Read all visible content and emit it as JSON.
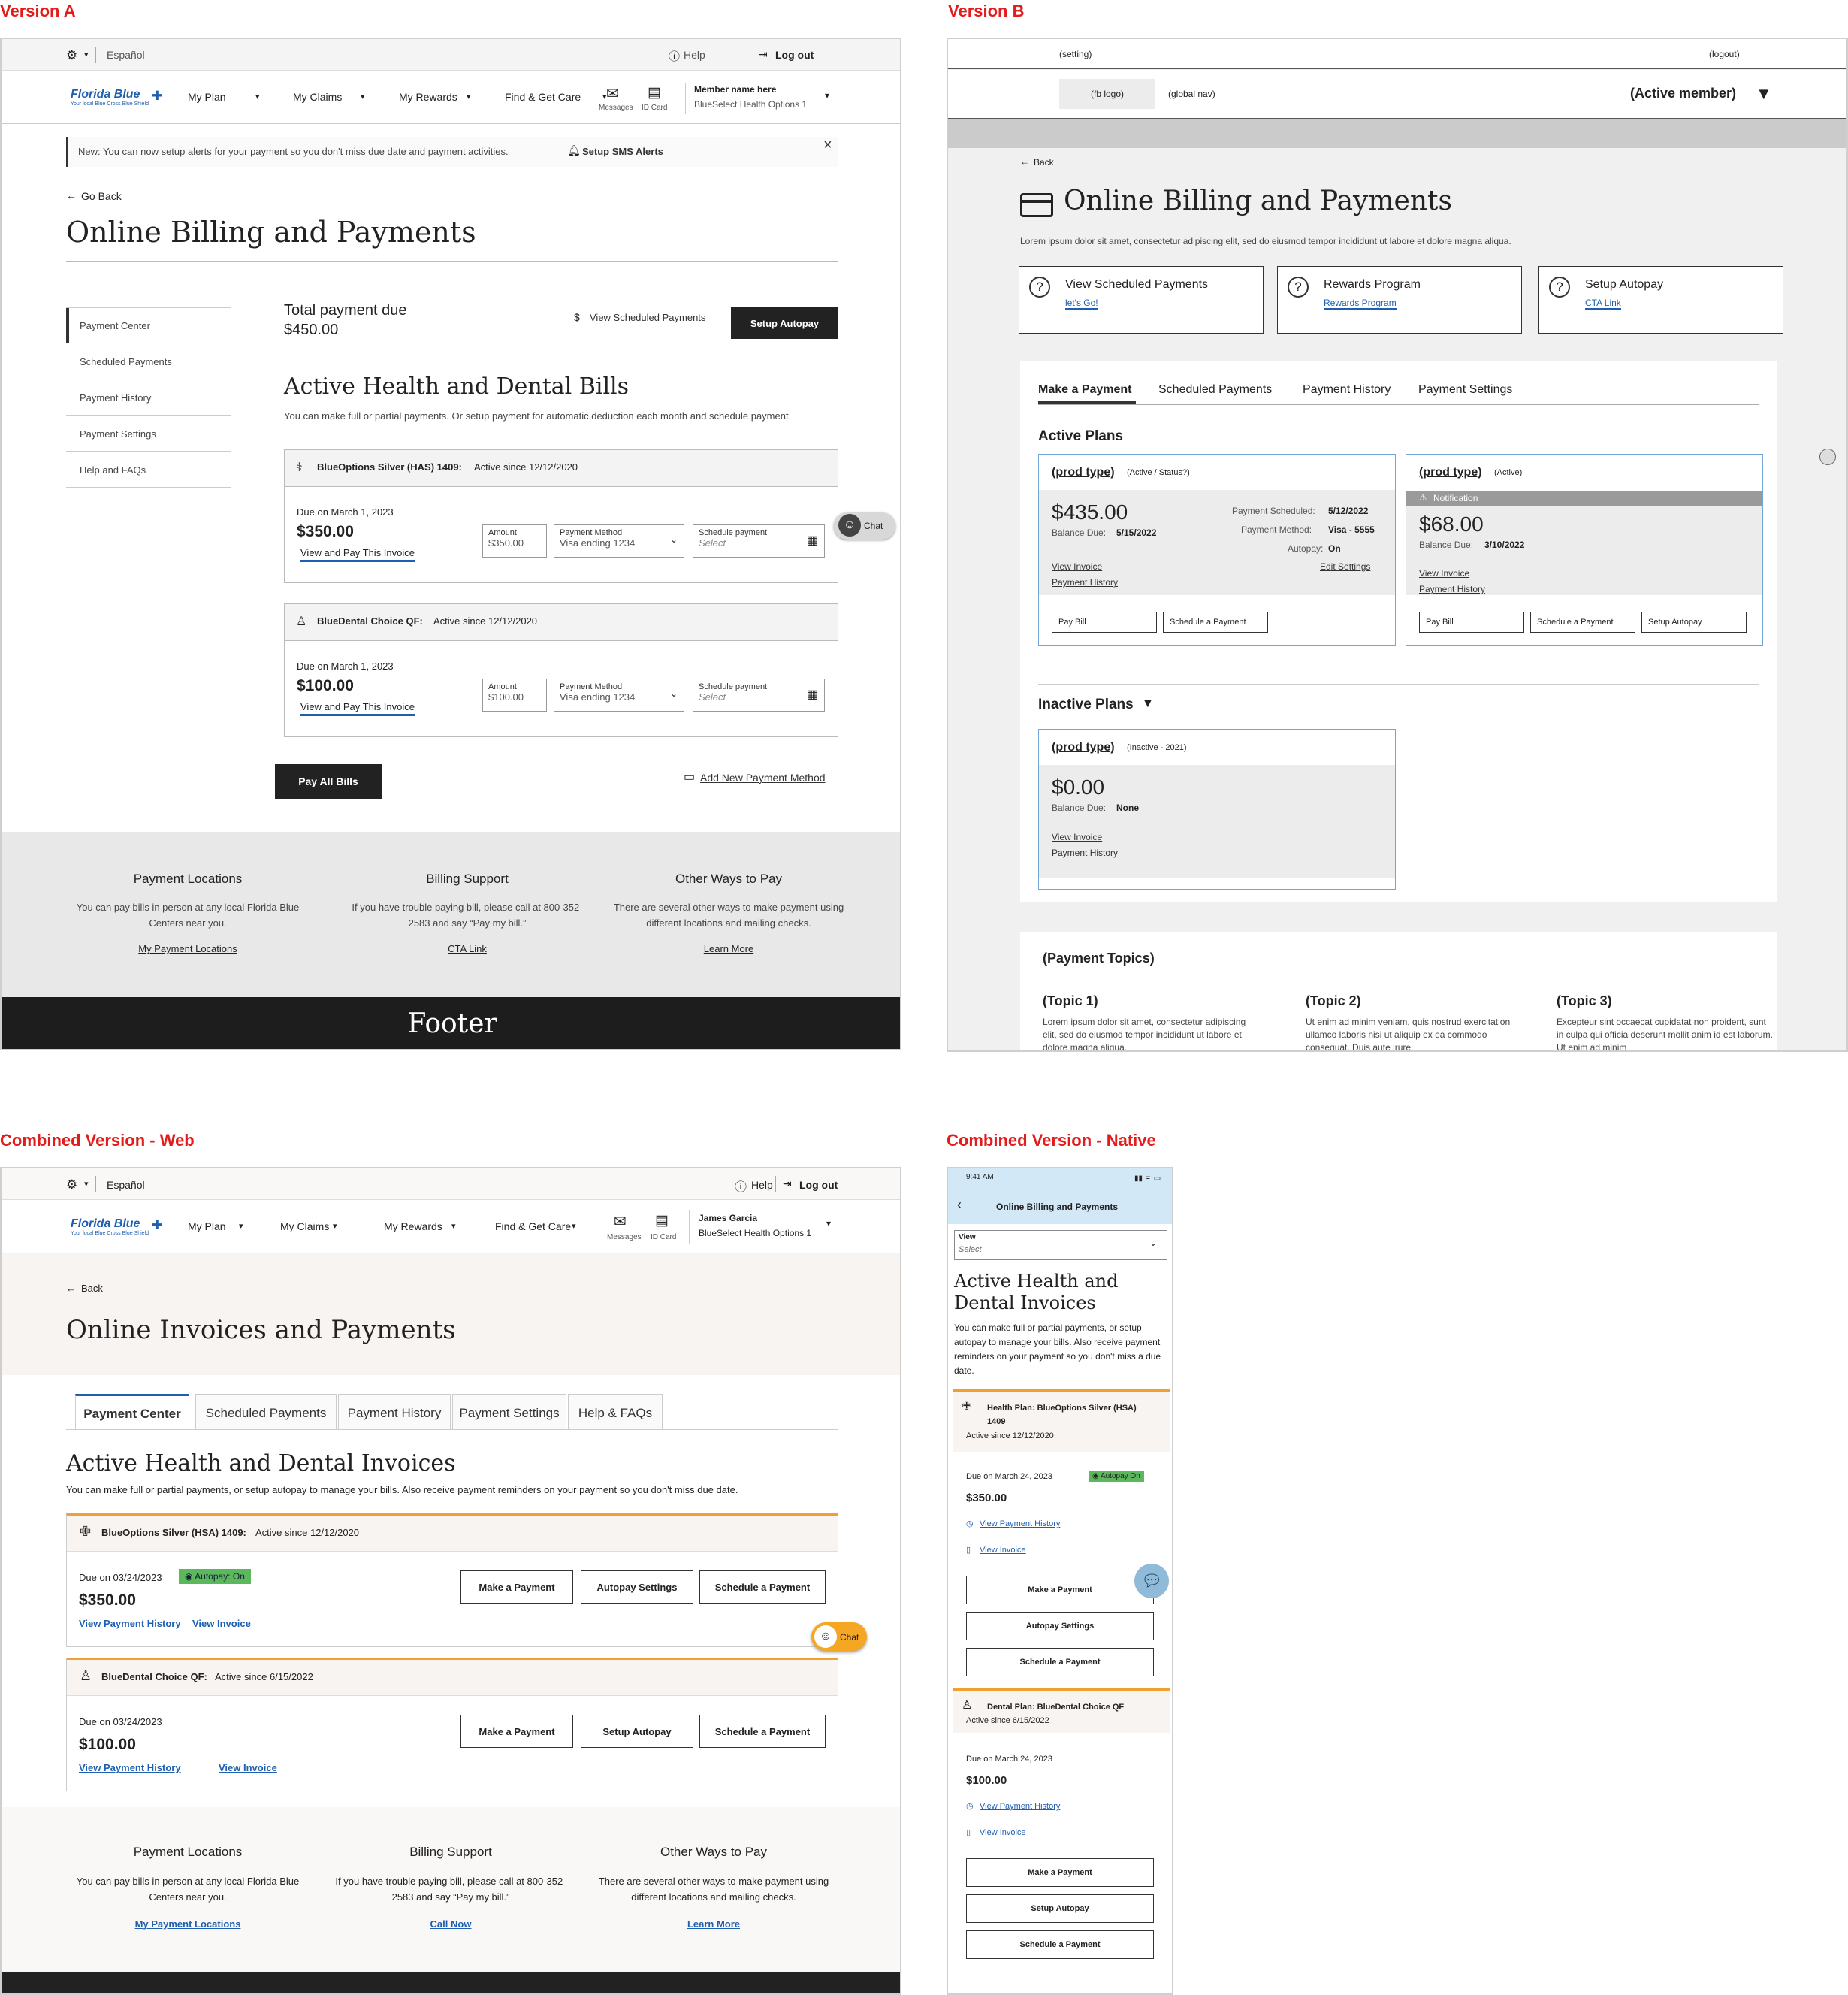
{
  "labels": {
    "a": "Version A",
    "b": "Version B",
    "web": "Combined Version - Web",
    "native": "Combined Version - Native"
  },
  "va": {
    "util": {
      "lang": "Español",
      "help": "Help",
      "logout": "Log out"
    },
    "logo": {
      "name": "Florida Blue",
      "tag": "Your local Blue Cross Blue Shield"
    },
    "nav": [
      "My Plan",
      "My Claims",
      "My Rewards",
      "Find & Get Care"
    ],
    "messages": "Messages",
    "idcard": "ID Card",
    "member": {
      "name": "Member name here",
      "plan": "BlueSelect Health Options 1"
    },
    "alert": {
      "text": "New: You can now setup alerts for your payment so you don't miss due date and payment activities.",
      "cta": "Setup SMS Alerts"
    },
    "back": "Go Back",
    "title": "Online Billing and Payments",
    "side": [
      "Payment Center",
      "Scheduled Payments",
      "Payment History",
      "Payment Settings",
      "Help and FAQs"
    ],
    "total_label": "Total payment due",
    "total": "$450.00",
    "view_sched": "View Scheduled Payments",
    "setup_autopay": "Setup Autopay",
    "sec_title": "Active Health and Dental Bills",
    "sec_sub": "You can make full or partial payments. Or setup payment for automatic deduction each month and schedule payment.",
    "plans": [
      {
        "name": "BlueOptions Silver (HAS) 1409:",
        "since": "Active since 12/12/2020",
        "due": "Due on March 1, 2023",
        "amount": "$350.00",
        "link": "View and Pay This Invoice",
        "amt_label": "Amount",
        "amt_val": "$350.00",
        "pm_label": "Payment Method",
        "pm_val": "Visa ending 1234",
        "sch_label": "Schedule payment",
        "sch_val": "Select"
      },
      {
        "name": "BlueDental Choice QF:",
        "since": "Active since 12/12/2020",
        "due": "Due on March 1, 2023",
        "amount": "$100.00",
        "link": "View and Pay This Invoice",
        "amt_label": "Amount",
        "amt_val": "$100.00",
        "pm_label": "Payment Method",
        "pm_val": "Visa ending 1234",
        "sch_label": "Schedule payment",
        "sch_val": "Select"
      }
    ],
    "chat": "Chat",
    "pay_all": "Pay All Bills",
    "add_pm": "Add New Payment Method",
    "footer_cols": [
      {
        "title": "Payment Locations",
        "body": "You can pay bills in person at any local Florida Blue Centers near you.",
        "cta": "My Payment Locations"
      },
      {
        "title": "Billing Support",
        "body": "If you have trouble paying bill, please call at 800-352-2583 and say “Pay my bill.”",
        "cta": "CTA Link"
      },
      {
        "title": "Other Ways to Pay",
        "body": "There are several other ways to make payment using different locations and mailing checks.",
        "cta": "Learn More"
      }
    ],
    "footer": "Footer"
  },
  "vb": {
    "setting": "(setting)",
    "logout": "(logout)",
    "logo": "(fb logo)",
    "gnav": "(global nav)",
    "member": "(Active member)",
    "back": "Back",
    "title": "Online Billing and Payments",
    "sub": "Lorem ipsum dolor sit amet, consectetur adipiscing elit, sed do eiusmod tempor incididunt ut labore et dolore magna aliqua.",
    "cards": [
      {
        "t": "View Scheduled Payments",
        "l": "let's Go!"
      },
      {
        "t": "Rewards Program",
        "l": "Rewards Program"
      },
      {
        "t": "Setup Autopay",
        "l": "CTA Link"
      }
    ],
    "tabs": [
      "Make a Payment",
      "Scheduled Payments",
      "Payment History",
      "Payment Settings"
    ],
    "active_plans": "Active Plans",
    "plan1": {
      "type": "(prod type)",
      "status": "(Active / Status?)",
      "amount": "$435.00",
      "bd_label": "Balance Due:",
      "bd": "5/15/2022",
      "ps_label": "Payment Scheduled:",
      "ps": "5/12/2022",
      "pm_label": "Payment Method:",
      "pm": "Visa - 5555",
      "ap_label": "Autopay:",
      "ap": "On",
      "vi": "View Invoice",
      "ph": "Payment History",
      "es": "Edit Settings",
      "b1": "Pay Bill",
      "b2": "Schedule a Payment"
    },
    "plan2": {
      "type": "(prod type)",
      "status": "(Active)",
      "notif": "Notification",
      "amount": "$68.00",
      "bd_label": "Balance Due:",
      "bd": "3/10/2022",
      "vi": "View Invoice",
      "ph": "Payment History",
      "b1": "Pay Bill",
      "b2": "Schedule a Payment",
      "b3": "Setup Autopay"
    },
    "inactive": "Inactive Plans",
    "plan3": {
      "type": "(prod type)",
      "status": "(Inactive - 2021)",
      "amount": "$0.00",
      "bd_label": "Balance Due:",
      "bd": "None",
      "vi": "View Invoice",
      "ph": "Payment History"
    },
    "topics": "(Payment Topics)",
    "topic_items": [
      {
        "t": "(Topic 1)",
        "b": "Lorem ipsum dolor sit amet, consectetur adipiscing elit, sed do eiusmod tempor incididunt ut labore et dolore magna aliqua."
      },
      {
        "t": "(Topic 2)",
        "b": "Ut enim ad minim veniam, quis nostrud exercitation ullamco laboris nisi ut aliquip ex ea commodo consequat. Duis aute irure"
      },
      {
        "t": "(Topic 3)",
        "b": "Excepteur sint occaecat cupidatat non proident, sunt in culpa qui officia deserunt mollit anim id est laborum. Ut enim ad minim"
      }
    ]
  },
  "cw": {
    "util": {
      "lang": "Español",
      "help": "Help",
      "logout": "Log out"
    },
    "nav": [
      "My Plan",
      "My Claims",
      "My Rewards",
      "Find & Get Care"
    ],
    "messages": "Messages",
    "idcard": "ID Card",
    "member": {
      "name": "James Garcia",
      "plan": "BlueSelect Health Options 1"
    },
    "back": "Back",
    "title": "Online Invoices and Payments",
    "tabs": [
      "Payment Center",
      "Scheduled Payments",
      "Payment History",
      "Payment Settings",
      "Help & FAQs"
    ],
    "sec_title": "Active Health and Dental Invoices",
    "sec_sub": "You can make full or partial payments, or setup autopay to manage your bills. Also receive payment reminders on your payment so you don't miss due date.",
    "plans": [
      {
        "name": "BlueOptions Silver (HSA) 1409:",
        "since": "Active since 12/12/2020",
        "due": "Due on 03/24/2023",
        "badge": "Autopay: On",
        "amount": "$350.00",
        "l1": "View Payment History",
        "l2": "View Invoice",
        "b1": "Make a Payment",
        "b2": "Autopay Settings",
        "b3": "Schedule a Payment"
      },
      {
        "name": "BlueDental Choice QF:",
        "since": "Active since 6/15/2022",
        "due": "Due on 03/24/2023",
        "amount": "$100.00",
        "l1": "View Payment History",
        "l2": "View Invoice",
        "b1": "Make a Payment",
        "b2": "Setup Autopay",
        "b3": "Schedule a Payment"
      }
    ],
    "chat": "Chat",
    "footer_cols": [
      {
        "title": "Payment Locations",
        "body": "You can pay bills in person at any local Florida Blue Centers near you.",
        "cta": "My Payment Locations"
      },
      {
        "title": "Billing Support",
        "body": "If you have trouble paying bill, please call at 800-352-2583 and say “Pay my bill.”",
        "cta": "Call Now"
      },
      {
        "title": "Other Ways to Pay",
        "body": "There are several other ways to make payment using different locations and mailing checks.",
        "cta": "Learn More"
      }
    ]
  },
  "cn": {
    "time": "9:41 AM",
    "title": "Online Billing and Payments",
    "view_label": "View",
    "view_val": "Select",
    "h1": "Active Health and Dental Invoices",
    "sub": "You can make full or partial payments, or setup autopay to manage your bills. Also receive payment reminders on your payment so you don't miss a due date.",
    "plans": [
      {
        "name": "Health Plan: BlueOptions Silver (HSA) 1409",
        "since": "Active since 12/12/2020",
        "due": "Due on March 24, 2023",
        "badge": "Autopay On",
        "amount": "$350.00",
        "l1": "View Payment History",
        "l2": "View Invoice",
        "b1": "Make a Payment",
        "b2": "Autopay Settings",
        "b3": "Schedule a Payment"
      },
      {
        "name": "Dental Plan: BlueDental Choice QF",
        "since": "Active since 6/15/2022",
        "due": "Due on March 24, 2023",
        "amount": "$100.00",
        "l1": "View Payment History",
        "l2": "View Invoice",
        "b1": "Make a Payment",
        "b2": "Setup Autopay",
        "b3": "Schedule a Payment"
      }
    ]
  }
}
